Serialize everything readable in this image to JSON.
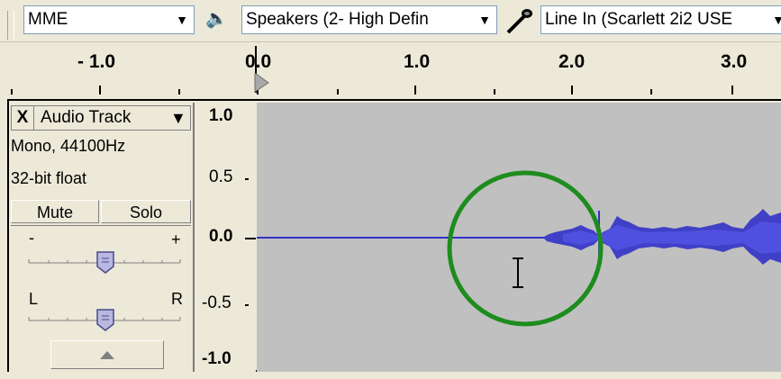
{
  "toolbar": {
    "host": "MME",
    "output_device": "Speakers (2- High Defin",
    "input_device": "Line In (Scarlett 2i2 USE"
  },
  "ruler": {
    "labels": [
      "- 1.0",
      "0.0",
      "1.0",
      "2.0",
      "3.0"
    ]
  },
  "track": {
    "close_symbol": "X",
    "name": "Audio Track",
    "format": "Mono, 44100Hz",
    "bitdepth": "32-bit float",
    "mute_label": "Mute",
    "solo_label": "Solo",
    "gain_minus": "-",
    "gain_plus": "+",
    "pan_left": "L",
    "pan_right": "R"
  },
  "vertical_scale": [
    "1.0",
    "0.5",
    "0.0",
    "-0.5",
    "-1.0"
  ],
  "colors": {
    "waveform": "#3232c8",
    "highlight_circle": "#1e8c1e",
    "wave_bg": "#c0c0c0"
  }
}
